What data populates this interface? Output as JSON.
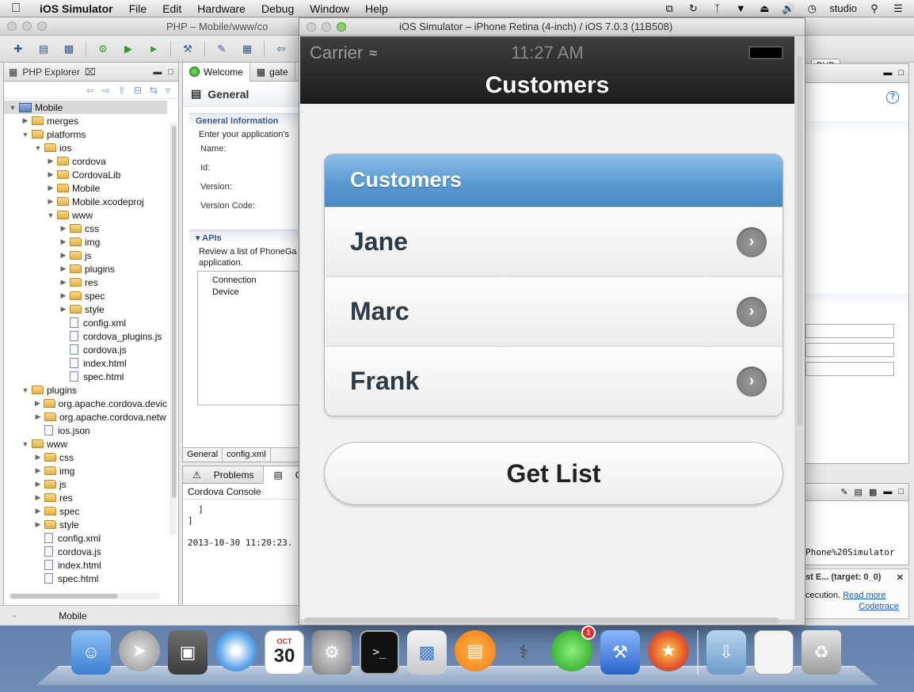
{
  "menubar": {
    "app_name": "iOS Simulator",
    "items": [
      "File",
      "Edit",
      "Hardware",
      "Debug",
      "Window",
      "Help"
    ],
    "user": "studio"
  },
  "eclipse": {
    "window_title": "PHP – Mobile/www/co",
    "explorer_title": "PHP Explorer",
    "tree": [
      {
        "label": "Mobile",
        "depth": 0,
        "kind": "project",
        "open": true
      },
      {
        "label": "merges",
        "depth": 1,
        "kind": "folder",
        "open": false
      },
      {
        "label": "platforms",
        "depth": 1,
        "kind": "folder",
        "open": true
      },
      {
        "label": "ios",
        "depth": 2,
        "kind": "folder",
        "open": true
      },
      {
        "label": "cordova",
        "depth": 3,
        "kind": "folder",
        "open": false
      },
      {
        "label": "CordovaLib",
        "depth": 3,
        "kind": "folder",
        "open": false
      },
      {
        "label": "Mobile",
        "depth": 3,
        "kind": "folder",
        "open": false
      },
      {
        "label": "Mobile.xcodeproj",
        "depth": 3,
        "kind": "folder",
        "open": false
      },
      {
        "label": "www",
        "depth": 3,
        "kind": "folder",
        "open": true
      },
      {
        "label": "css",
        "depth": 4,
        "kind": "folder",
        "open": false
      },
      {
        "label": "img",
        "depth": 4,
        "kind": "folder",
        "open": false
      },
      {
        "label": "js",
        "depth": 4,
        "kind": "folder",
        "open": false
      },
      {
        "label": "plugins",
        "depth": 4,
        "kind": "folder",
        "open": false
      },
      {
        "label": "res",
        "depth": 4,
        "kind": "folder",
        "open": false
      },
      {
        "label": "spec",
        "depth": 4,
        "kind": "folder",
        "open": false
      },
      {
        "label": "style",
        "depth": 4,
        "kind": "folder",
        "open": false
      },
      {
        "label": "config.xml",
        "depth": 4,
        "kind": "file"
      },
      {
        "label": "cordova_plugins.js",
        "depth": 4,
        "kind": "file"
      },
      {
        "label": "cordova.js",
        "depth": 4,
        "kind": "file"
      },
      {
        "label": "index.html",
        "depth": 4,
        "kind": "file"
      },
      {
        "label": "spec.html",
        "depth": 4,
        "kind": "file"
      },
      {
        "label": "plugins",
        "depth": 1,
        "kind": "folder",
        "open": true
      },
      {
        "label": "org.apache.cordova.devic",
        "depth": 2,
        "kind": "folder",
        "open": false
      },
      {
        "label": "org.apache.cordova.netw",
        "depth": 2,
        "kind": "folder",
        "open": false
      },
      {
        "label": "ios.json",
        "depth": 2,
        "kind": "file"
      },
      {
        "label": "www",
        "depth": 1,
        "kind": "folder",
        "open": true
      },
      {
        "label": "css",
        "depth": 2,
        "kind": "folder",
        "open": false
      },
      {
        "label": "img",
        "depth": 2,
        "kind": "folder",
        "open": false
      },
      {
        "label": "js",
        "depth": 2,
        "kind": "folder",
        "open": false
      },
      {
        "label": "res",
        "depth": 2,
        "kind": "folder",
        "open": false
      },
      {
        "label": "spec",
        "depth": 2,
        "kind": "folder",
        "open": false
      },
      {
        "label": "style",
        "depth": 2,
        "kind": "folder",
        "open": false
      },
      {
        "label": "config.xml",
        "depth": 2,
        "kind": "file"
      },
      {
        "label": "cordova.js",
        "depth": 2,
        "kind": "file"
      },
      {
        "label": "index.html",
        "depth": 2,
        "kind": "file"
      },
      {
        "label": "spec.html",
        "depth": 2,
        "kind": "file"
      }
    ],
    "editor_tabs": [
      "Welcome",
      "gate"
    ],
    "editor_heading": "General",
    "general_info_title": "General Information",
    "general_info_desc": "Enter your application's",
    "fields": [
      "Name:",
      "Id:",
      "Version:",
      "Version Code:"
    ],
    "apis_title": "APIs",
    "apis_desc_1": "Review a list of PhoneGa",
    "apis_desc_2": "application.",
    "apis": [
      "Connection",
      "Device"
    ],
    "bottom_tabs": [
      "General",
      "config.xml"
    ],
    "console_tabs": [
      "Problems",
      "Console"
    ],
    "console_name": "Cordova Console",
    "console_lines": [
      "  ]",
      "]",
      "",
      "2013-10-30 11:20:23."
    ],
    "status_project": "Mobile",
    "perspective_label": "PHP",
    "right_console_tail": "Phone%20Simulator",
    "notice_title": "st E... (target: 0_0)",
    "notice_text": "cecution.",
    "notice_link_1": "Read more",
    "notice_link_2": "Codetrace"
  },
  "simulator": {
    "window_title": "iOS Simulator – iPhone Retina (4-inch) / iOS 7.0.3 (11B508)",
    "carrier": "Carrier",
    "time": "11:27 AM",
    "nav_title": "Customers",
    "list_header": "Customers",
    "customers": [
      "Jane",
      "Marc",
      "Frank"
    ],
    "button_label": "Get List"
  },
  "dock": {
    "calendar_month": "OCT",
    "calendar_day": "30",
    "badge_count": "1"
  }
}
